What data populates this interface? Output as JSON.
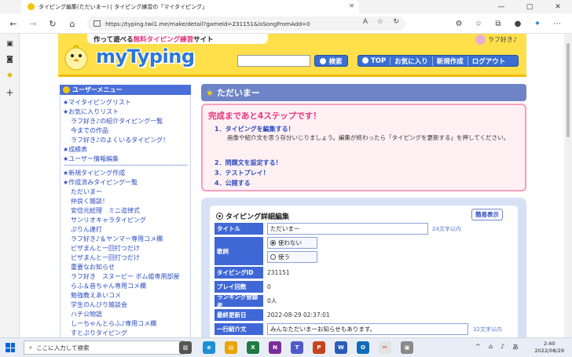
{
  "browser": {
    "tab_title": "タイピング編集(ただいまー) | タイピング練習の「マイタイピング」",
    "url": "https://typing.twi1.me/make/detail?gameId=231151&isSongFromAdd=0"
  },
  "site": {
    "catch_prefix": "作って遊べる",
    "catch_highlight": "無料タイピング練習",
    "catch_suffix": "サイト",
    "logo": "myTyping",
    "user_name": "ラフ好き♪",
    "search_button": "検索",
    "nav": [
      "TOP",
      "お気に入り",
      "新規作成",
      "ログアウト"
    ]
  },
  "menu": {
    "title": "ユーザーメニュー",
    "items": [
      {
        "label": "★マイタイピングリスト",
        "indent": false
      },
      {
        "label": "★お気に入りリスト",
        "indent": false
      },
      {
        "label": "ラフ好き♪の紹介タイピング一覧",
        "indent": true
      },
      {
        "label": "今までの作品",
        "indent": true
      },
      {
        "label": "ラフ好き♪のよくいるタイピング！",
        "indent": true
      },
      {
        "label": "★成績表",
        "indent": false
      },
      {
        "label": "★ユーザー情報編集",
        "indent": false
      },
      {
        "label": "★新規タイピング作成",
        "indent": false
      },
      {
        "label": "★作成済みタイピング一覧",
        "indent": false
      },
      {
        "label": "ただいまー",
        "indent": true
      },
      {
        "label": "仲良く雑談！",
        "indent": true
      },
      {
        "label": "安倍元総理　ミニ追悼式",
        "indent": true
      },
      {
        "label": "サンリオキャラタイピング",
        "indent": true
      },
      {
        "label": "ぷりん連打",
        "indent": true
      },
      {
        "label": "ラフ好き♪＆ヤンマー専用コメ欄",
        "indent": true
      },
      {
        "label": "ピザまんと一回打つだけ",
        "indent": true
      },
      {
        "label": "ピザまんと一回打つだけ",
        "indent": true
      },
      {
        "label": "重要なお知らせ",
        "indent": true
      },
      {
        "label": "ラフ好き　スヌーピー ボム姫専用部屋",
        "indent": true
      },
      {
        "label": "らふ＆音ちゃん専用コメ欄",
        "indent": true
      },
      {
        "label": "勉強教えあいコメ",
        "indent": true
      },
      {
        "label": "学生のんびり雑談会",
        "indent": true
      },
      {
        "label": "ハチ公物語",
        "indent": true
      },
      {
        "label": "しーちゃんとらふ♪専用コメ欄",
        "indent": true
      },
      {
        "label": "すとぷりタイピング",
        "indent": true
      }
    ]
  },
  "content": {
    "header": "ただいまー",
    "steps_title": "完成まであと4ステップです！",
    "steps": [
      "1．タイピングを編集する！",
      "2．問題文を設定する！",
      "3．テストプレイ！",
      "4．公開する"
    ],
    "step1_desc": "画像や紹介文を思う存分いじりましょう。編集が終わったら「タイピングを更新する」を押してください。",
    "edit_title": "タイピング詳細編集",
    "simple_view": "簡易表示",
    "fields": {
      "title_label": "タイトル",
      "title_value": "ただいまー",
      "title_hint": "24文字以内",
      "lyrics_label": "歌詞",
      "lyrics_opt1": "使わない",
      "lyrics_opt2": "使う",
      "id_label": "タイピングID",
      "id_value": "231151",
      "plays_label": "プレイ回数",
      "plays_value": "0",
      "ranking_label": "ランキング登録者",
      "ranking_value": "0人",
      "updated_label": "最終更新日",
      "updated_value": "2022-08-29 02:37:01",
      "intro_label": "一行紹介文",
      "intro_value": "みんなただいまーお知らせもあります。",
      "intro_hint": "32文字以内"
    }
  },
  "taskbar": {
    "search_placeholder": "ここに入力して検索",
    "time": "2:40",
    "date": "2022/08/29",
    "ime": "あ"
  },
  "colors": {
    "header_yellow": "#ffe04a",
    "nav_blue": "#3a6fd1",
    "menu_blue": "#4a6fd8",
    "accent_pink": "#e8337a",
    "label_blue": "#3f68d6"
  }
}
